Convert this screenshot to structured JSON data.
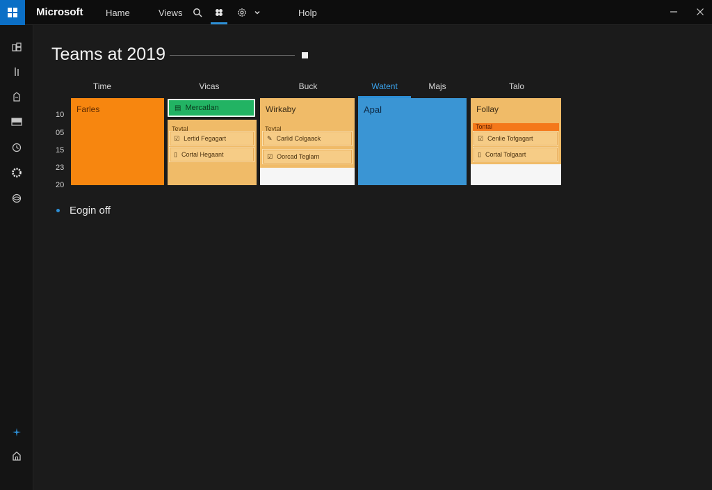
{
  "topbar": {
    "brand": "Microsoft",
    "nav": {
      "home": "Hame",
      "views": "Views",
      "help": "Holp"
    },
    "icons": [
      "search-icon",
      "grid-icon",
      "settings-icon",
      "chevron-down-icon",
      "minimize-icon",
      "close-icon"
    ]
  },
  "rail": {
    "icons": [
      "apps-icon",
      "bar-icon",
      "files-icon",
      "inbox-icon",
      "clock-icon",
      "gear-icon",
      "globe-icon",
      "sparkle-icon",
      "home-icon"
    ]
  },
  "main": {
    "title": "Teams at 2019",
    "columns": [
      "Time",
      "Vicas",
      "Buck",
      "Watent",
      "Majs",
      "Talo"
    ],
    "active_column": "Watent",
    "row_labels": [
      "10",
      "05",
      "15",
      "23",
      "20"
    ],
    "cards": {
      "c1": {
        "title": "Farles"
      },
      "c2": {
        "chip": "Mercatlan",
        "sub_label": "Teytal",
        "tasks": [
          "Lertid Fegagart",
          "Cortal Hegaant"
        ]
      },
      "c3": {
        "title": "Wirkaby",
        "sub_label": "Teytal",
        "tasks": [
          "Carlid Colgaack",
          "Oorcad Teglarn"
        ]
      },
      "c4": {
        "title": "Apal"
      },
      "c5": {
        "title": "Follay",
        "sub_label": "Tontal",
        "tasks": [
          "Cenlie Tofgagart",
          "Cortal Tolgaart"
        ]
      }
    },
    "status": "Eogin off"
  },
  "colors": {
    "accent": "#2d8fd6",
    "orange": "#f7860f",
    "tan": "#f0bb68",
    "blue": "#3a95d4",
    "green": "#22b363",
    "background": "#1b1b1b"
  }
}
